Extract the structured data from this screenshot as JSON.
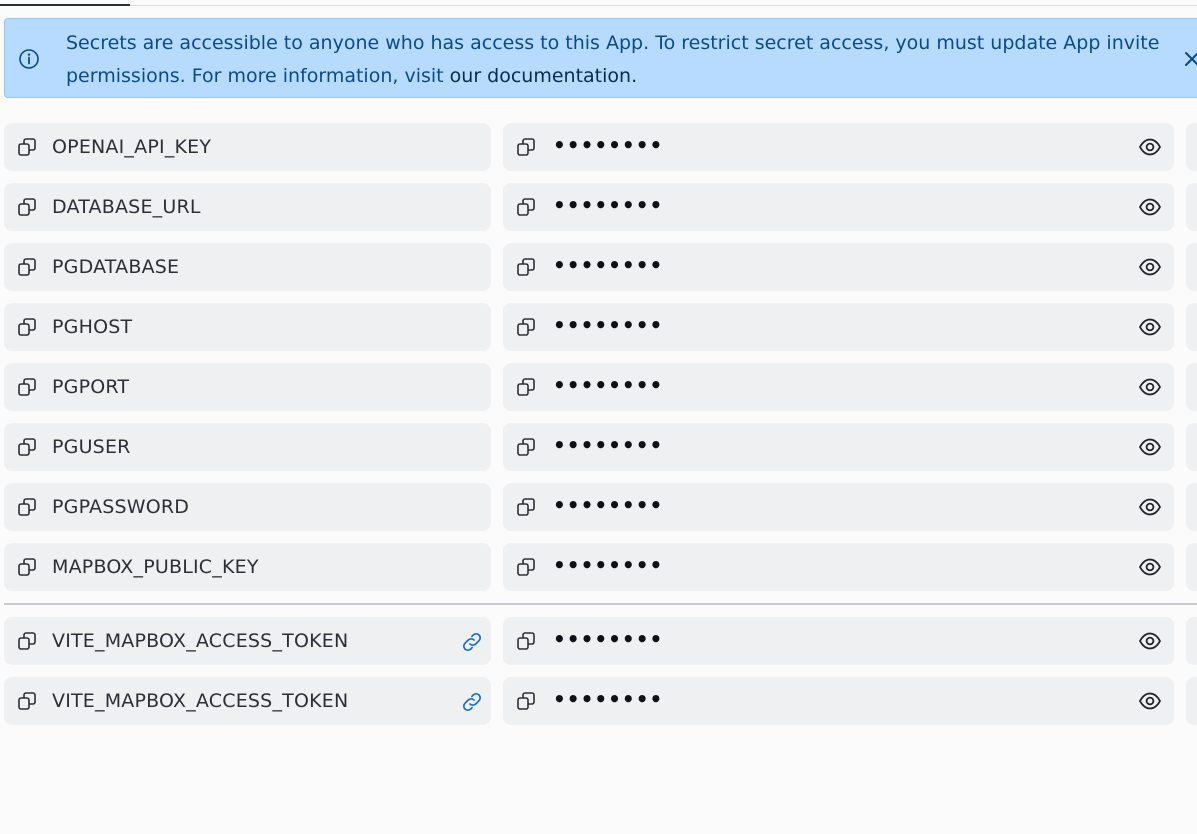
{
  "banner": {
    "message": "Secrets are accessible to anyone who has access to this App. To restrict secret access, you must update App invite permissions. For more information, visit",
    "link_text": "our documentation.",
    "icon": "info-icon",
    "close_icon": "close-icon",
    "accent": "#b6dbff"
  },
  "secrets": [
    {
      "key": "OPENAI_API_KEY",
      "value": "••••••••"
    },
    {
      "key": "DATABASE_URL",
      "value": "••••••••"
    },
    {
      "key": "PGDATABASE",
      "value": "••••••••"
    },
    {
      "key": "PGHOST",
      "value": "••••••••"
    },
    {
      "key": "PGPORT",
      "value": "••••••••"
    },
    {
      "key": "PGUSER",
      "value": "••••••••"
    },
    {
      "key": "PGPASSWORD",
      "value": "••••••••"
    },
    {
      "key": "MAPBOX_PUBLIC_KEY",
      "value": "••••••••"
    }
  ],
  "linked_secrets": [
    {
      "key": "VITE_MAPBOX_ACCESS_TOKEN",
      "value": "••••••••",
      "icon": "link-icon"
    },
    {
      "key": "VITE_MAPBOX_ACCESS_TOKEN",
      "value": "••••••••",
      "icon": "link-icon"
    }
  ]
}
